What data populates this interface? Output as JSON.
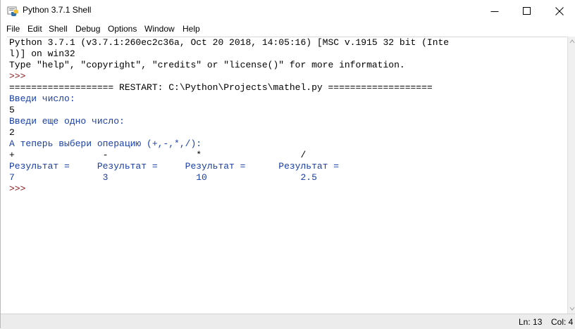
{
  "window": {
    "title": "Python 3.7.1 Shell",
    "controls": {
      "minimize": "—",
      "maximize": "☐",
      "close": "✕"
    }
  },
  "menu": [
    "File",
    "Edit",
    "Shell",
    "Debug",
    "Options",
    "Window",
    "Help"
  ],
  "shell": {
    "lines": [
      {
        "text": "Python 3.7.1 (v3.7.1:260ec2c36a, Oct 20 2018, 14:05:16) [MSC v.1915 32 bit (Inte",
        "kind": "out"
      },
      {
        "text": "l)] on win32",
        "kind": "out"
      },
      {
        "text": "Type \"help\", \"copyright\", \"credits\" or \"license()\" for more information.",
        "kind": "out"
      },
      {
        "text": ">>> ",
        "kind": "prm"
      },
      {
        "text": "=================== RESTART: C:\\Python\\Projects\\mathel.py ===================",
        "kind": "out"
      },
      {
        "text": "Введи число:",
        "kind": "stdout"
      },
      {
        "text": "5",
        "kind": "stdin"
      },
      {
        "text": "Введи еще одно число:",
        "kind": "stdout"
      },
      {
        "text": "2",
        "kind": "stdin"
      },
      {
        "text": "А теперь выбери операцию (+,-,*,/):",
        "kind": "stdout"
      },
      {
        "text": "+                -                *                  /",
        "kind": "stdin"
      },
      {
        "text": "Результат =     Результат =     Результат =      Результат =",
        "kind": "stdout"
      },
      {
        "text": "7                3                10                 2.5",
        "kind": "stdout"
      },
      {
        "text": ">>> ",
        "kind": "prm"
      }
    ]
  },
  "status": {
    "line": "Ln: 13",
    "col": "Col: 4"
  },
  "colors": {
    "prompt": "#8b1a1a",
    "stdout": "#1a3fa6",
    "text": "#000000"
  }
}
